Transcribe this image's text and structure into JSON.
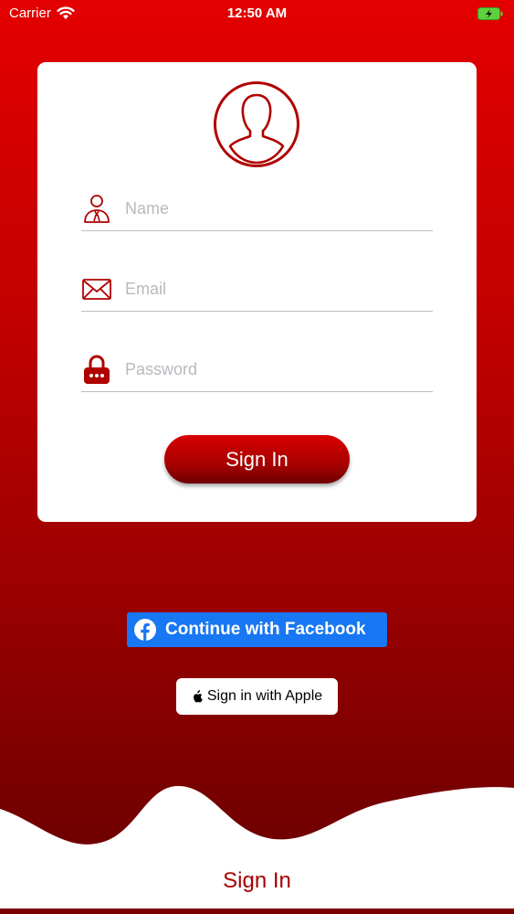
{
  "status_bar": {
    "carrier": "Carrier",
    "time": "12:50 AM"
  },
  "form": {
    "name_placeholder": "Name",
    "email_placeholder": "Email",
    "password_placeholder": "Password",
    "signin_label": "Sign In"
  },
  "social": {
    "facebook_label": "Continue with Facebook",
    "apple_label": "Sign in with Apple"
  },
  "footer": {
    "title": "Sign In"
  },
  "colors": {
    "accent": "#b00000",
    "facebook": "#1877f2",
    "battery": "#5cd13b"
  },
  "icons": [
    "wifi-icon",
    "battery-icon",
    "user-avatar-icon",
    "person-icon",
    "mail-icon",
    "lock-icon",
    "facebook-icon",
    "apple-icon"
  ]
}
